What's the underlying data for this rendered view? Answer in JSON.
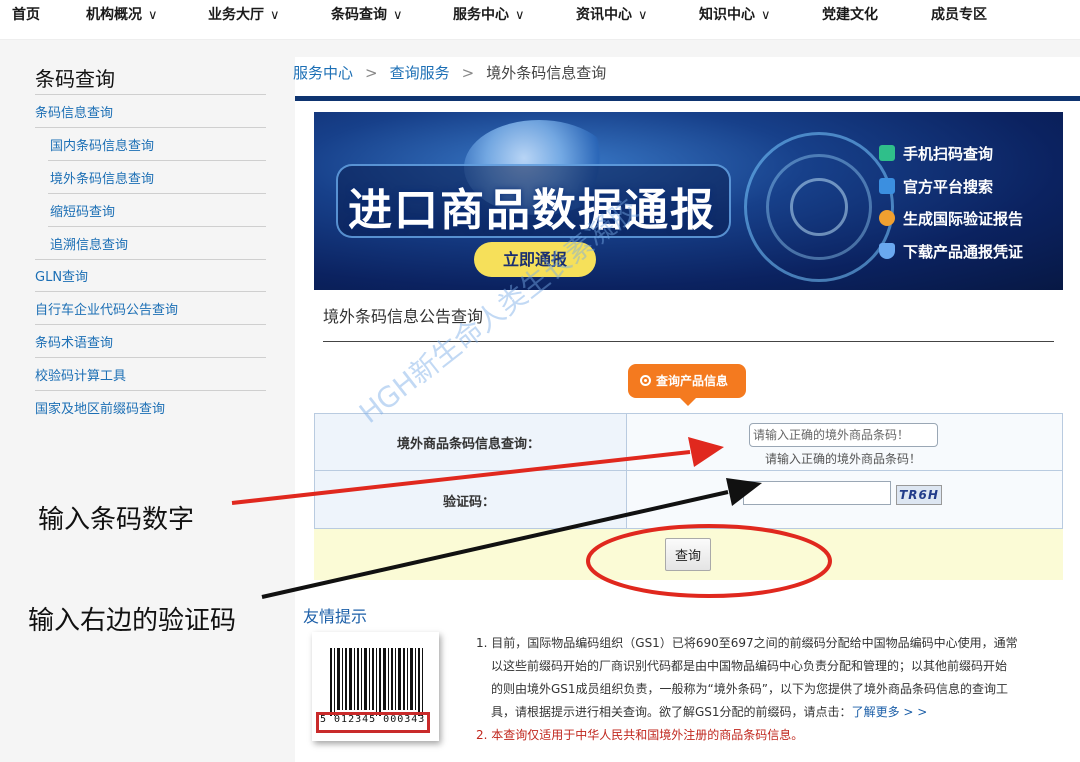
{
  "topnav": {
    "items": [
      "首页",
      "机构概况",
      "业务大厅",
      "条码查询",
      "服务中心",
      "资讯中心",
      "知识中心",
      "党建文化",
      "成员专区"
    ]
  },
  "sidebar": {
    "title": "条码查询",
    "items": {
      "barcode_info": "条码信息查询",
      "domestic": "国内条码信息查询",
      "foreign": "境外条码信息查询",
      "short_code": "缩短码查询",
      "trace": "追溯信息查询",
      "gln": "GLN查询",
      "bicycle": "自行车企业代码公告查询",
      "glossary": "条码术语查询",
      "check_digit": "校验码计算工具",
      "prefix": "国家及地区前缀码查询"
    }
  },
  "breadcrumb": {
    "level1": "服务中心",
    "sep": ">",
    "level2": "查询服务",
    "current": "境外条码信息查询"
  },
  "banner": {
    "headline": "进口商品数据通报",
    "button": "立即通报",
    "features": [
      "手机扫码查询",
      "官方平台搜索",
      "生成国际验证报告",
      "下载产品通报凭证"
    ]
  },
  "section": {
    "title": "境外条码信息公告查询"
  },
  "query_tab": {
    "label": "查询产品信息"
  },
  "form": {
    "barcode_label": "境外商品条码信息查询：",
    "barcode_placeholder": "请输入正确的境外商品条码！",
    "barcode_hint": "请输入正确的境外商品条码！",
    "captcha_label": "验证码：",
    "captcha_value": "",
    "captcha_image_text": "TR6H",
    "search_button": "查询"
  },
  "tips": {
    "title": "友情提示",
    "barcode_number": "5 012345 000343",
    "line1": "1. 目前，国际物品编码组织（GS1）已将690至697之间的前缀码分配给中国物品编码中心使用，通常",
    "line2": "以这些前缀码开始的厂商识别代码都是由中国物品编码中心负责分配和管理的；以其他前缀码开始",
    "line3": "的则由境外GS1成员组织负责，一般称为“境外条码”，以下为您提供了境外商品条码信息的查询工",
    "line4_prefix": "具，请根据提示进行相关查询。欲了解GS1分配的前缀码，请点击：",
    "line4_link": "了解更多 > >",
    "line5": "2. 本查询仅适用于中华人民共和国境外注册的商品条码信息。"
  },
  "annotations": {
    "label1": "输入条码数字",
    "label2": "输入右边的验证码",
    "watermark": "HGH新生命人类生长素凝胶",
    "red": "#e0281e",
    "black": "#111111"
  },
  "colors": {
    "nav_blue": "#0e3470",
    "link_blue": "#1c6fb5",
    "orange": "#f47a1f"
  }
}
